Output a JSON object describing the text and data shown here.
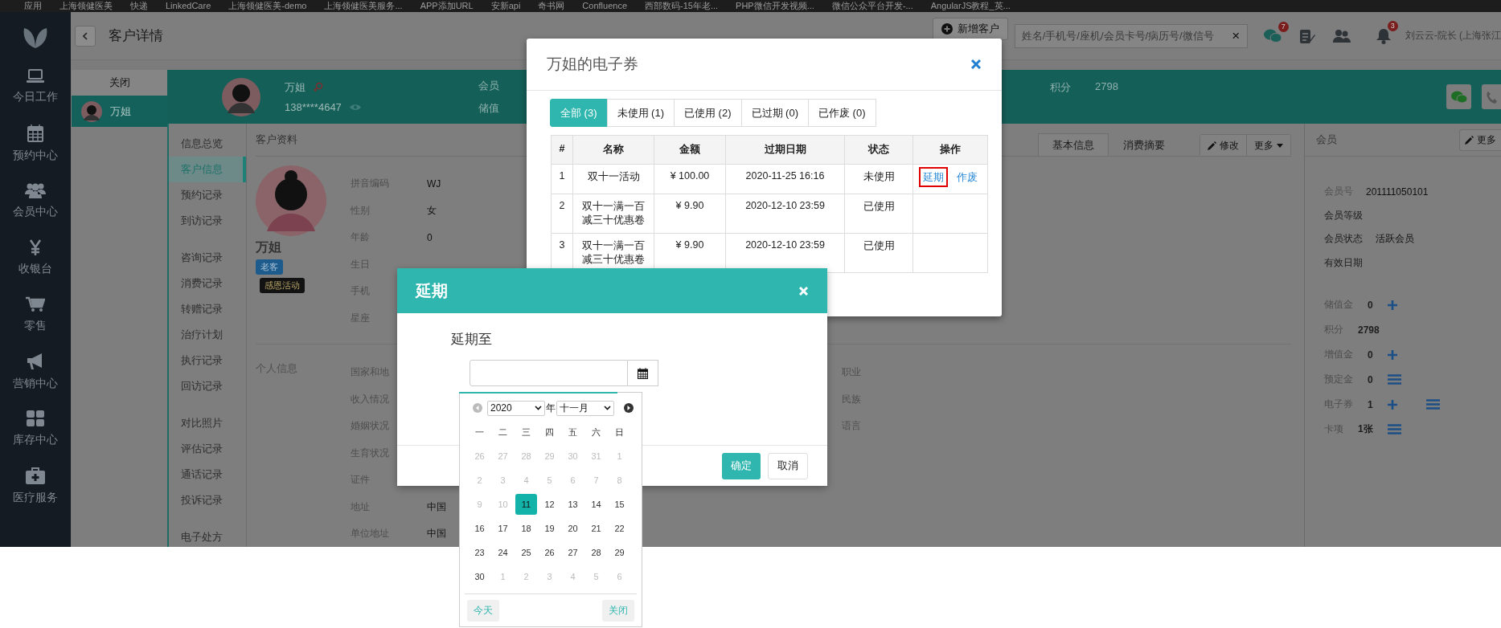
{
  "bookmarks": [
    "应用",
    "上海领健医美",
    "快递",
    "LinkedCare",
    "上海领健医美-demo",
    "上海领健医美服务...",
    "APP添加URL",
    "安新api",
    "奇书网",
    "Confluence",
    "西部数码-15年老...",
    "PHP微信开发视频...",
    "微信公众平台开发-...",
    "AngularJS教程_英..."
  ],
  "sidebar": {
    "items": [
      "今日工作",
      "预约中心",
      "会员中心",
      "收银台",
      "零售",
      "营销中心",
      "库存中心",
      "医疗服务"
    ]
  },
  "header": {
    "title": "客户详情",
    "new_button": "新增客户",
    "search": {
      "placeholder": "姓名/手机号/座机/会员卡号/病历号/微信号",
      "clear": "×"
    },
    "chat_badge": "7",
    "bell_badge": "3",
    "user": "刘云云-院长 (上海张江"
  },
  "customer_list": {
    "close": "关闭",
    "items": [
      {
        "name": "万姐",
        "selected": true
      }
    ]
  },
  "profile_header": {
    "name": "万姐",
    "phone": "138****4647",
    "member_labels": [
      "会员",
      "储值"
    ],
    "points_label": "积分",
    "points": "2798"
  },
  "nav": {
    "groups": [
      {
        "items": [
          {
            "label": "信息总览",
            "selected": false
          },
          {
            "label": "客户信息",
            "selected": true
          },
          {
            "label": "预约记录",
            "selected": false
          },
          {
            "label": "到访记录",
            "selected": false
          }
        ]
      },
      {
        "items": [
          {
            "label": "咨询记录",
            "selected": false
          },
          {
            "label": "消费记录",
            "selected": false
          },
          {
            "label": "转赠记录",
            "selected": false
          },
          {
            "label": "治疗计划",
            "selected": false
          },
          {
            "label": "执行记录",
            "selected": false
          },
          {
            "label": "回访记录",
            "selected": false
          }
        ]
      },
      {
        "items": [
          {
            "label": "对比照片",
            "selected": false
          },
          {
            "label": "评估记录",
            "selected": false
          },
          {
            "label": "通话记录",
            "selected": false
          },
          {
            "label": "投诉记录",
            "selected": false
          }
        ]
      },
      {
        "items": [
          {
            "label": "电子处方",
            "selected": false
          }
        ]
      }
    ]
  },
  "section_title": "客户资料",
  "tabs": [
    {
      "label": "基本信息",
      "selected": true
    },
    {
      "label": "消费摘要",
      "selected": false
    }
  ],
  "actions": {
    "edit": "修改",
    "more": "更多"
  },
  "customer": {
    "name": "万姐",
    "tags": [
      {
        "label": "老客",
        "kind": "level"
      },
      {
        "label": "感恩活动",
        "kind": "event"
      }
    ]
  },
  "basic_fields": [
    {
      "label": "拼音编码",
      "value": "WJ"
    },
    {
      "label": "性别",
      "value": "女"
    },
    {
      "label": "年龄",
      "value": "0"
    },
    {
      "label": "生日"
    },
    {
      "label": "手机"
    },
    {
      "label": "星座"
    }
  ],
  "personal_title": "个人信息",
  "personal_fields": [
    {
      "label": "国家和地"
    },
    {
      "label": "收入情况"
    },
    {
      "label": "婚姻状况"
    },
    {
      "label": "生育状况"
    },
    {
      "label": "证件"
    },
    {
      "label": "地址",
      "value": "中国"
    },
    {
      "label": "单位地址",
      "value": "中国"
    }
  ],
  "personal_fields_right": [
    {
      "label": "职业"
    },
    {
      "label": "民族"
    },
    {
      "label": "语言"
    }
  ],
  "member": {
    "title": "会员",
    "more": "更多",
    "rows": [
      {
        "label": "会员号",
        "value": "201111050101"
      },
      {
        "label": "会员等级"
      },
      {
        "label": "会员状态",
        "value": "活跃会员"
      },
      {
        "label": "有效日期"
      }
    ],
    "balances": [
      {
        "label": "储值金",
        "value": "0",
        "add": true,
        "list": false
      },
      {
        "label": "积分",
        "value": "2798",
        "add": false,
        "list": false
      },
      {
        "label": "增值金",
        "value": "0",
        "add": true,
        "list": false
      },
      {
        "label": "预定金",
        "value": "0",
        "add": false,
        "list": true
      },
      {
        "label": "电子券",
        "value": "1",
        "add": true,
        "list": true
      },
      {
        "label": "卡项",
        "value": "1张",
        "add": false,
        "list": true
      }
    ]
  },
  "coupon_dialog": {
    "title": "万姐的电子券",
    "filters": [
      {
        "label": "全部 (3)",
        "selected": true
      },
      {
        "label": "未使用 (1)",
        "selected": false
      },
      {
        "label": "已使用 (2)",
        "selected": false
      },
      {
        "label": "已过期 (0)",
        "selected": false
      },
      {
        "label": "已作废 (0)",
        "selected": false
      }
    ],
    "columns": [
      "#",
      "名称",
      "金额",
      "过期日期",
      "状态",
      "操作"
    ],
    "rows": [
      {
        "index": "1",
        "name": "双十一活动",
        "amount": "¥ 100.00",
        "expires": "2020-11-25 16:16",
        "status": "未使用",
        "actions": [
          {
            "label": "延期",
            "highlighted": true
          },
          {
            "label": "作废",
            "highlighted": false
          }
        ]
      },
      {
        "index": "2",
        "name": "双十一满一百减三十优惠卷",
        "amount": "¥ 9.90",
        "expires": "2020-12-10 23:59",
        "status": "已使用",
        "actions": []
      },
      {
        "index": "3",
        "name": "双十一满一百减三十优惠卷",
        "amount": "¥ 9.90",
        "expires": "2020-12-10 23:59",
        "status": "已使用",
        "actions": []
      }
    ]
  },
  "extend_dialog": {
    "title": "延期",
    "label": "延期至",
    "confirm": "确定",
    "cancel": "取消"
  },
  "datepicker": {
    "year": "2020",
    "year_suffix": "年",
    "month": "十一月",
    "weekdays": [
      "一",
      "二",
      "三",
      "四",
      "五",
      "六",
      "日"
    ],
    "days": [
      {
        "label": "26",
        "muted": true,
        "selected": false
      },
      {
        "label": "27",
        "muted": true,
        "selected": false
      },
      {
        "label": "28",
        "muted": true,
        "selected": false
      },
      {
        "label": "29",
        "muted": true,
        "selected": false
      },
      {
        "label": "30",
        "muted": true,
        "selected": false
      },
      {
        "label": "31",
        "muted": true,
        "selected": false
      },
      {
        "label": "1",
        "muted": true,
        "selected": false
      },
      {
        "label": "2",
        "muted": true,
        "selected": false
      },
      {
        "label": "3",
        "muted": true,
        "selected": false
      },
      {
        "label": "4",
        "muted": true,
        "selected": false
      },
      {
        "label": "5",
        "muted": true,
        "selected": false
      },
      {
        "label": "6",
        "muted": true,
        "selected": false
      },
      {
        "label": "7",
        "muted": true,
        "selected": false
      },
      {
        "label": "8",
        "muted": true,
        "selected": false
      },
      {
        "label": "9",
        "muted": true,
        "selected": false
      },
      {
        "label": "10",
        "muted": true,
        "selected": false
      },
      {
        "label": "11",
        "muted": false,
        "selected": true
      },
      {
        "label": "12",
        "muted": false,
        "selected": false
      },
      {
        "label": "13",
        "muted": false,
        "selected": false
      },
      {
        "label": "14",
        "muted": false,
        "selected": false
      },
      {
        "label": "15",
        "muted": false,
        "selected": false
      },
      {
        "label": "16",
        "muted": false,
        "selected": false
      },
      {
        "label": "17",
        "muted": false,
        "selected": false
      },
      {
        "label": "18",
        "muted": false,
        "selected": false
      },
      {
        "label": "19",
        "muted": false,
        "selected": false
      },
      {
        "label": "20",
        "muted": false,
        "selected": false
      },
      {
        "label": "21",
        "muted": false,
        "selected": false
      },
      {
        "label": "22",
        "muted": false,
        "selected": false
      },
      {
        "label": "23",
        "muted": false,
        "selected": false
      },
      {
        "label": "24",
        "muted": false,
        "selected": false
      },
      {
        "label": "25",
        "muted": false,
        "selected": false
      },
      {
        "label": "26",
        "muted": false,
        "selected": false
      },
      {
        "label": "27",
        "muted": false,
        "selected": false
      },
      {
        "label": "28",
        "muted": false,
        "selected": false
      },
      {
        "label": "29",
        "muted": false,
        "selected": false
      },
      {
        "label": "30",
        "muted": false,
        "selected": false
      },
      {
        "label": "1",
        "muted": true,
        "selected": false
      },
      {
        "label": "2",
        "muted": true,
        "selected": false
      },
      {
        "label": "3",
        "muted": true,
        "selected": false
      },
      {
        "label": "4",
        "muted": true,
        "selected": false
      },
      {
        "label": "5",
        "muted": true,
        "selected": false
      },
      {
        "label": "6",
        "muted": true,
        "selected": false
      }
    ],
    "today": "今天",
    "close": "关闭"
  }
}
